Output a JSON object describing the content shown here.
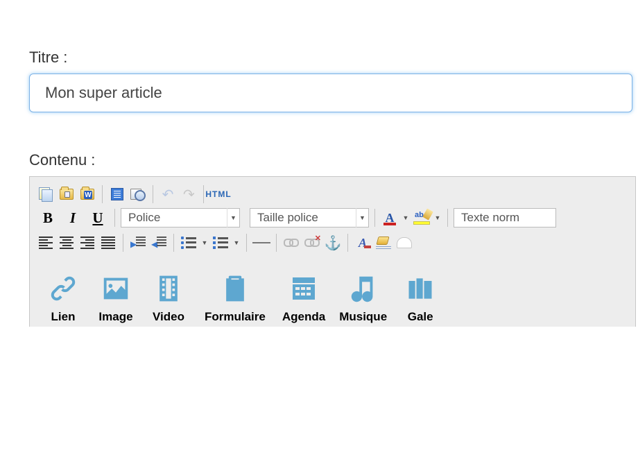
{
  "form": {
    "title_label": "Titre :",
    "title_value": "Mon super article",
    "content_label": "Contenu :"
  },
  "toolbar": {
    "font_dropdown": "Police",
    "fontsize_dropdown": "Taille police",
    "format_dropdown": "Texte norm",
    "html_label": "HTML",
    "folder_w": "W"
  },
  "biu": {
    "bold": "B",
    "italic": "I",
    "underline": "U"
  },
  "insert": {
    "link": "Lien",
    "image": "Image",
    "video": "Video",
    "form": "Formulaire",
    "agenda": "Agenda",
    "music": "Musique",
    "gallery": "Gale"
  }
}
